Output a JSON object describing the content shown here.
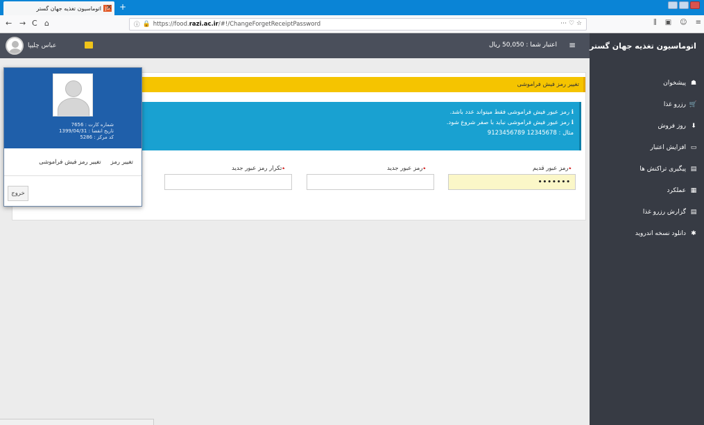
{
  "browser": {
    "tab_title": "اتوماسیون تغذیه جهان گستر",
    "favicon_text": "JG",
    "close_glyph": "×",
    "new_tab_glyph": "+",
    "back_glyph": "←",
    "forward_glyph": "→",
    "reload_glyph": "C",
    "home_glyph": "⌂",
    "info_glyph": "ⓘ",
    "url_prefix": "https://food.",
    "url_domain": "razi.ac.ir",
    "url_path": "/#!/ChangeForgetReceiptPassword",
    "url_icons": "⋯ ♡ ☆",
    "toolbar_icons": [
      "⫼",
      "▣",
      "☺",
      "≡"
    ]
  },
  "header": {
    "brand": "اتوماسیون تغذیه جهان گستر",
    "menu_glyph": "≡",
    "credit": "اعتبار شما : 50,050 ریال",
    "user_name": "عباس چلیپا"
  },
  "sidebar": {
    "items": [
      {
        "icon": "☗",
        "label": "پیشخوان"
      },
      {
        "icon": "🛒",
        "label": "رزرو غذا"
      },
      {
        "icon": "⬇",
        "label": "روز فروش"
      },
      {
        "icon": "▭",
        "label": "افزایش اعتبار"
      },
      {
        "icon": "▤",
        "label": "پیگیری تراکنش ها"
      },
      {
        "icon": "▦",
        "label": "عملکرد"
      },
      {
        "icon": "▤",
        "label": "گزارش رزرو غذا"
      },
      {
        "icon": "✱",
        "label": "دانلود نسخه اندروید"
      }
    ]
  },
  "page": {
    "title": "تغییر رمز فیش فراموشی",
    "notes": [
      "رمز عبور فیش فراموشی فقط میتواند عدد باشد.",
      "رمز عبور فیش فراموشی نباید با صفر شروع شود."
    ],
    "example": "مثال : 12345678    9123456789",
    "fields": {
      "old_label": "رمز عبور قدیم",
      "old_value": "•••••••",
      "new_label": "رمز عبور جدید",
      "new_value": "",
      "repeat_label": "تکرار رمز عبور جدید",
      "repeat_value": ""
    },
    "required_mark": "٭"
  },
  "dropdown": {
    "card_number": "شماره کارت : 7656",
    "expiry": "تاریخ انقضا : 1399/04/31",
    "center_code": "کد مرکز : 5286",
    "link_change_password": "تغییر رمز",
    "link_change_forget": "تغییر رمز فیش فراموشی",
    "logout": "خروج"
  },
  "colors": {
    "header_bg": "#4a4f5b",
    "sidebar_bg": "#373b44",
    "title_bar": "#f5c400",
    "alert_bg": "#19a1d1",
    "dropdown_top": "#1f5faa"
  }
}
